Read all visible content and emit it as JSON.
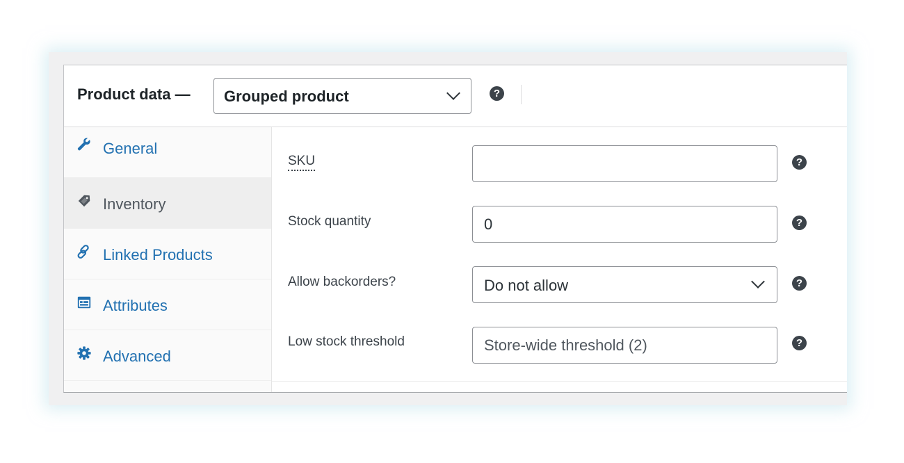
{
  "header": {
    "title": "Product data —",
    "product_type": "Grouped product"
  },
  "tabs": [
    {
      "label": "General",
      "icon": "wrench-icon"
    },
    {
      "label": "Inventory",
      "icon": "tag-icon"
    },
    {
      "label": "Linked Products",
      "icon": "link-icon"
    },
    {
      "label": "Attributes",
      "icon": "list-icon"
    },
    {
      "label": "Advanced",
      "icon": "gear-icon"
    }
  ],
  "active_tab": "Inventory",
  "inventory": {
    "sku": {
      "label": "SKU",
      "value": ""
    },
    "stock_quantity": {
      "label": "Stock quantity",
      "value": "0"
    },
    "backorders": {
      "label": "Allow backorders?",
      "value": "Do not allow"
    },
    "low_stock": {
      "label": "Low stock threshold",
      "placeholder": "Store-wide threshold (2)"
    }
  },
  "colors": {
    "link": "#2271b1",
    "text": "#1d2327",
    "active_tab_bg": "#eeeeee",
    "help_icon": "#3c434a"
  }
}
